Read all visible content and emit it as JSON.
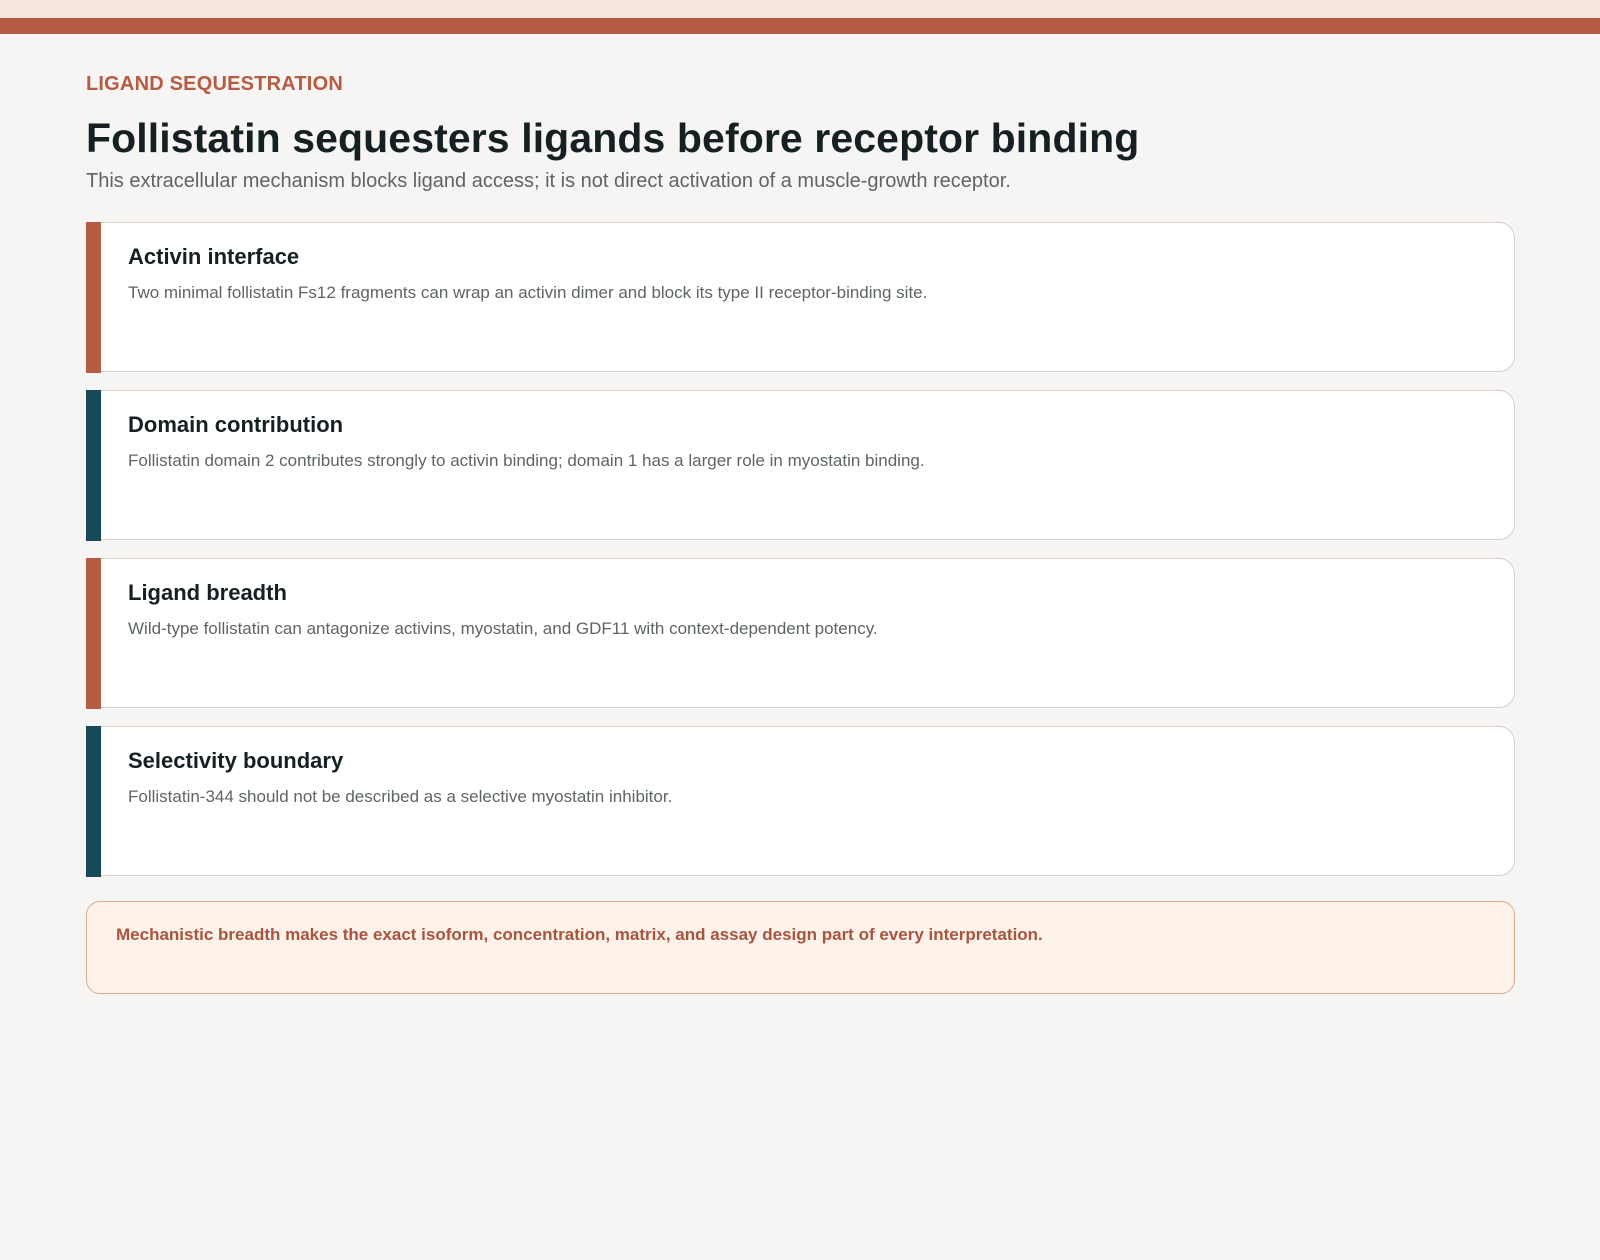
{
  "header": {
    "eyebrow": "LIGAND SEQUESTRATION",
    "title": "Follistatin sequesters ligands before receptor binding",
    "subtitle": "This extracellular mechanism blocks ligand access; it is not direct activation of a muscle-growth receptor."
  },
  "cards": [
    {
      "title": "Activin interface",
      "text": "Two minimal follistatin Fs12 fragments can wrap an activin dimer and block its type II receptor-binding site.",
      "accent": "#b65b44"
    },
    {
      "title": "Domain contribution",
      "text": "Follistatin domain 2 contributes strongly to activin binding; domain 1 has a larger role in myostatin binding.",
      "accent": "#174a59"
    },
    {
      "title": "Ligand breadth",
      "text": "Wild-type follistatin can antagonize activins, myostatin, and GDF11 with context-dependent potency.",
      "accent": "#b65b44"
    },
    {
      "title": "Selectivity boundary",
      "text": "Follistatin-344 should not be described as a selective myostatin inhibitor.",
      "accent": "#174a59"
    }
  ],
  "note": {
    "text": "Mechanistic breadth makes the exact isoform, concentration, matrix, and assay design part of every interpretation."
  },
  "colors": {
    "brand": "#b65b44",
    "teal": "#174a59",
    "title": "#162022",
    "muted": "#5f6466"
  }
}
